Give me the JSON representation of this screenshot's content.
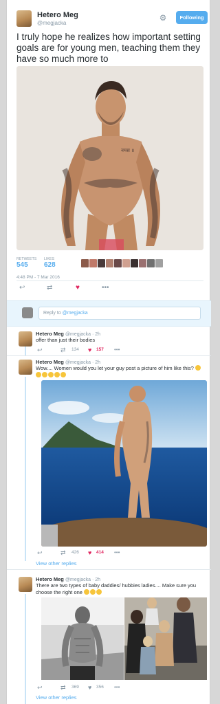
{
  "tweet": {
    "display_name": "Hetero Meg",
    "handle": "@megjacka",
    "follow_label": "Following",
    "text": "I truly hope he realizes how important setting goals are for young men, teaching them they have so much more to",
    "photo_tattoo": "नमस ॥",
    "stats": {
      "retweets_label": "RETWEETS",
      "retweets": "545",
      "likes_label": "LIKES",
      "likes": "628"
    },
    "timestamp": "4:48 PM - 7 Mar 2016",
    "icons": {
      "reply": "reply-icon",
      "retweet": "retweet-icon",
      "like": "heart-icon",
      "more": "more-icon",
      "settings": "gear-icon"
    }
  },
  "reply_box": {
    "prefix": "Reply to ",
    "mention": "@megjacka"
  },
  "replies": [
    {
      "name": "Hetero Meg",
      "meta": "@megjacka · 2h",
      "text": "offer than just their bodies",
      "retweets": "134",
      "likes": "157"
    },
    {
      "name": "Hetero Meg",
      "meta": "@megjacka · 2h",
      "text": "Wow.... Women would you let your guy post a picture of him like this?",
      "retweets": "426",
      "likes": "414",
      "view_replies": "View other replies"
    },
    {
      "name": "Hetero Meg",
      "meta": "@megjacka · 2h",
      "text": "There are two types of baby daddies/ hubbies ladies.... Make sure you choose the right one",
      "retweets": "369",
      "likes": "356",
      "view_replies": "View other replies"
    }
  ],
  "colors": {
    "accent": "#55acee",
    "like": "#e0245e",
    "muted": "#8899a6"
  }
}
